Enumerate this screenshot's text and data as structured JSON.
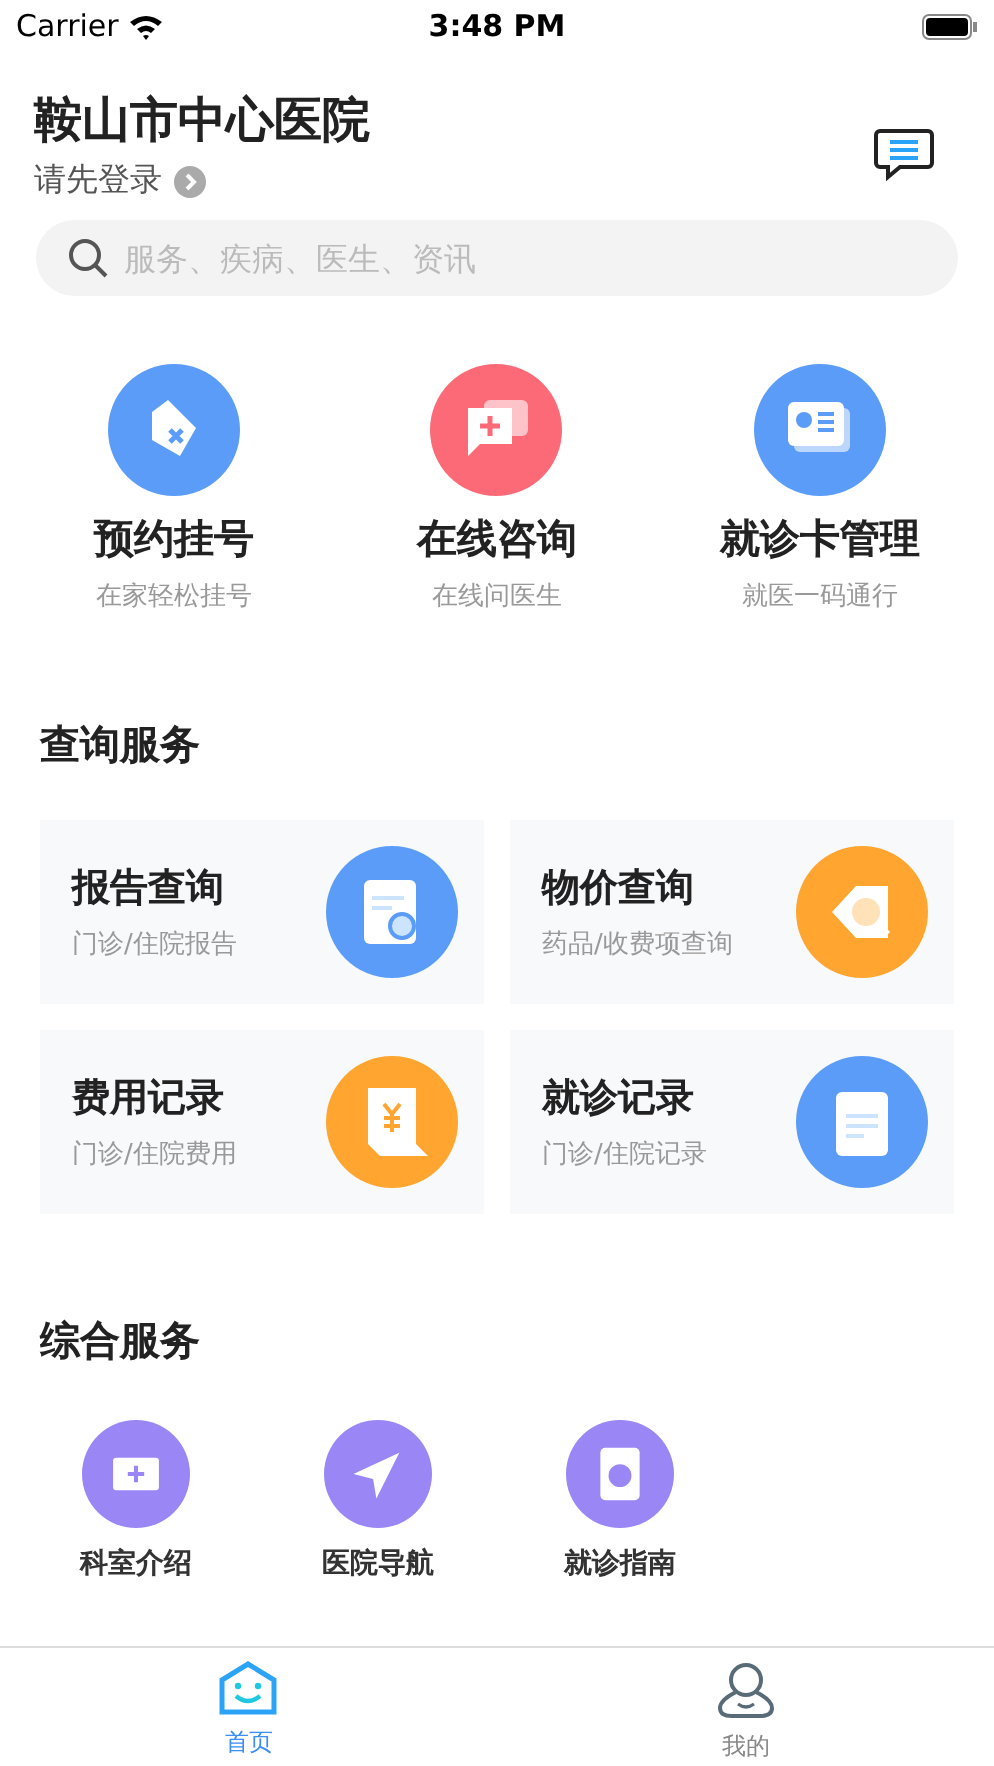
{
  "status_bar": {
    "carrier": "Carrier",
    "time": "3:48 PM"
  },
  "header": {
    "title": "鞍山市中心医院",
    "login": "请先登录"
  },
  "search": {
    "placeholder": "服务、疾病、医生、资讯"
  },
  "quick_actions": [
    {
      "title": "预约挂号",
      "subtitle": "在家轻松挂号",
      "color": "#5a9cf8"
    },
    {
      "title": "在线咨询",
      "subtitle": "在线问医生",
      "color": "#fb6a76"
    },
    {
      "title": "就诊卡管理",
      "subtitle": "就医一码通行",
      "color": "#5a9cf8"
    }
  ],
  "query_services": {
    "title": "查询服务",
    "cards": [
      {
        "title": "报告查询",
        "subtitle": "门诊/住院报告",
        "color": "#5a9cf8"
      },
      {
        "title": "物价查询",
        "subtitle": "药品/收费项查询",
        "color": "#ffa530"
      },
      {
        "title": "费用记录",
        "subtitle": "门诊/住院费用",
        "color": "#ffa530"
      },
      {
        "title": "就诊记录",
        "subtitle": "门诊/住院记录",
        "color": "#5a9cf8"
      }
    ]
  },
  "general_services": {
    "title": "综合服务",
    "items": [
      {
        "label": "科室介绍"
      },
      {
        "label": "医院导航"
      },
      {
        "label": "就诊指南"
      }
    ]
  },
  "tab_bar": [
    {
      "label": "首页",
      "selected": true
    },
    {
      "label": "我的",
      "selected": false
    }
  ]
}
